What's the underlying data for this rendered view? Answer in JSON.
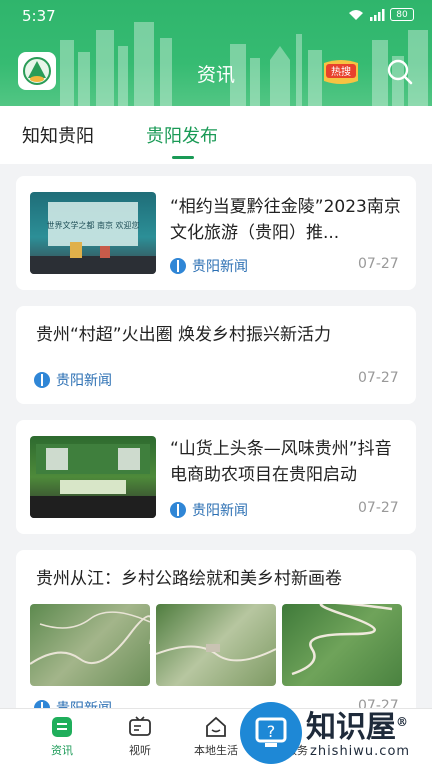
{
  "status": {
    "time": "5:37",
    "battery": "80"
  },
  "header": {
    "title": "资讯",
    "hot_badge": "热搜"
  },
  "tabs": [
    {
      "label": "知知贵阳",
      "active": false
    },
    {
      "label": "贵阳发布",
      "active": true
    }
  ],
  "articles": [
    {
      "title": "“相约当夏黔往金陵”2023南京文化旅游（贵阳）推...",
      "source": "贵阳新闻",
      "date": "07-27",
      "thumb_text": "世界文学之都 南京 欢迎您"
    },
    {
      "title": "贵州“村超”火出圈 焕发乡村振兴新活力",
      "source": "贵阳新闻",
      "date": "07-27"
    },
    {
      "title": "“山货上头条—风味贵州”抖音电商助农项目在贵阳启动",
      "source": "贵阳新闻",
      "date": "07-27"
    },
    {
      "title": "贵州从江：乡村公路绘就和美乡村新画卷",
      "source": "贵阳新闻",
      "date": "07-27"
    }
  ],
  "bottom_nav": [
    {
      "label": "资讯",
      "icon": "news-icon",
      "active": true
    },
    {
      "label": "视听",
      "icon": "video-icon",
      "active": false
    },
    {
      "label": "本地生活",
      "icon": "home-icon",
      "active": false
    },
    {
      "label": "政务服务",
      "icon": "service-icon",
      "active": false
    }
  ],
  "watermark": {
    "text": "知识屋",
    "sub": "zhishiwu.com",
    "mark": "®"
  },
  "colors": {
    "brand_green": "#1a9a56",
    "header_green": "#36bb72",
    "source_blue": "#2b6fb3"
  }
}
